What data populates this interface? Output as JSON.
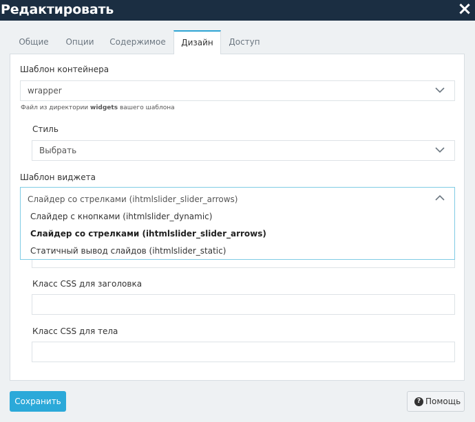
{
  "window": {
    "title": "Редактировать",
    "close_icon": "×"
  },
  "tabs": [
    {
      "label": "Общие"
    },
    {
      "label": "Опции"
    },
    {
      "label": "Содержимое"
    },
    {
      "label": "Дизайн",
      "active": true
    },
    {
      "label": "Доступ"
    }
  ],
  "form": {
    "container_template": {
      "label": "Шаблон контейнера",
      "value": "wrapper",
      "hint_prefix": "Файл из директории",
      "hint_bold": "widgets",
      "hint_suffix": "вашего шаблона"
    },
    "style": {
      "label": "Стиль",
      "value": "Выбрать"
    },
    "widget_template": {
      "label": "Шаблон виджета",
      "value": "Слайдер со стрелками (ihtmlslider_slider_arrows)",
      "options": [
        "Слайдер с кнопками (ihtmlslider_dynamic)",
        "Слайдер со стрелками (ihtmlslider_slider_arrows)",
        "Статичный вывод слайдов (ihtmlslider_static)"
      ],
      "selected_index": 1
    },
    "header_css": {
      "label": "Класс CSS для заголовка",
      "value": ""
    },
    "body_css": {
      "label": "Класс CSS для тела",
      "value": ""
    }
  },
  "buttons": {
    "save": "Сохранить",
    "help": "Помощь",
    "help_icon": "?"
  }
}
